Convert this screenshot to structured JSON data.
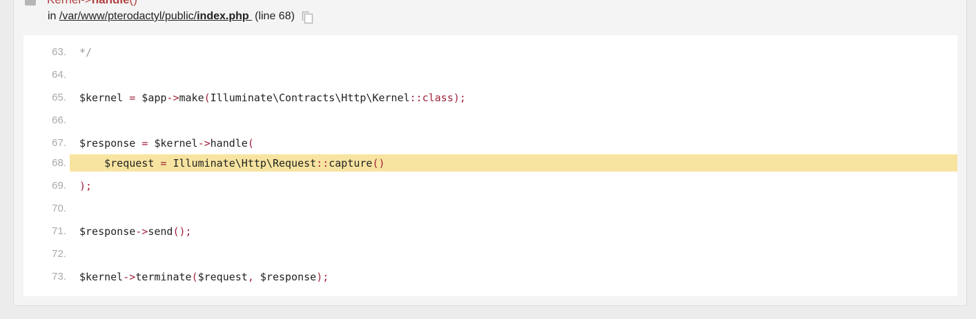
{
  "trace": {
    "class_name": "Kernel",
    "arrow": "->",
    "method": "handle",
    "args": "()",
    "in_label": "in",
    "path_prefix": "/var/www/pterodactyl/public/",
    "file_name": "index.php",
    "line_info": "(line 68)"
  },
  "code": {
    "highlight_line": 68,
    "lines": [
      {
        "no": "63.",
        "tokens": [
          {
            "t": "*/",
            "k": "cm"
          }
        ]
      },
      {
        "no": "64.",
        "tokens": []
      },
      {
        "no": "65.",
        "tokens": [
          {
            "t": "$kernel ",
            "k": ""
          },
          {
            "t": "=",
            "k": "op"
          },
          {
            "t": " $app",
            "k": ""
          },
          {
            "t": "->",
            "k": "op"
          },
          {
            "t": "make",
            "k": ""
          },
          {
            "t": "(",
            "k": "op"
          },
          {
            "t": "Illuminate\\Contracts\\Http\\Kernel",
            "k": ""
          },
          {
            "t": "::class);",
            "k": "op"
          }
        ]
      },
      {
        "no": "66.",
        "tokens": []
      },
      {
        "no": "67.",
        "tokens": [
          {
            "t": "$response ",
            "k": ""
          },
          {
            "t": "=",
            "k": "op"
          },
          {
            "t": " $kernel",
            "k": ""
          },
          {
            "t": "->",
            "k": "op"
          },
          {
            "t": "handle",
            "k": ""
          },
          {
            "t": "(",
            "k": "op"
          }
        ]
      },
      {
        "no": "68.",
        "tokens": [
          {
            "t": "    $request ",
            "k": ""
          },
          {
            "t": "=",
            "k": "op"
          },
          {
            "t": " Illuminate\\Http\\Request",
            "k": ""
          },
          {
            "t": "::",
            "k": "op"
          },
          {
            "t": "capture",
            "k": ""
          },
          {
            "t": "()",
            "k": "op"
          }
        ]
      },
      {
        "no": "69.",
        "tokens": [
          {
            "t": ");",
            "k": "op"
          }
        ]
      },
      {
        "no": "70.",
        "tokens": []
      },
      {
        "no": "71.",
        "tokens": [
          {
            "t": "$response",
            "k": ""
          },
          {
            "t": "->",
            "k": "op"
          },
          {
            "t": "send",
            "k": ""
          },
          {
            "t": "();",
            "k": "op"
          }
        ]
      },
      {
        "no": "72.",
        "tokens": []
      },
      {
        "no": "73.",
        "tokens": [
          {
            "t": "$kernel",
            "k": ""
          },
          {
            "t": "->",
            "k": "op"
          },
          {
            "t": "terminate",
            "k": ""
          },
          {
            "t": "(",
            "k": "op"
          },
          {
            "t": "$request",
            "k": ""
          },
          {
            "t": ",",
            "k": "op"
          },
          {
            "t": " $response",
            "k": ""
          },
          {
            "t": ");",
            "k": "op"
          }
        ]
      }
    ]
  },
  "colors": {
    "function_name": "#b0413e",
    "highlight": "#f7e4a0",
    "operator": "#a0223a",
    "comment": "#999999"
  },
  "icons": {
    "toggle": "collapse-toggle-icon",
    "copy": "copy-icon"
  }
}
